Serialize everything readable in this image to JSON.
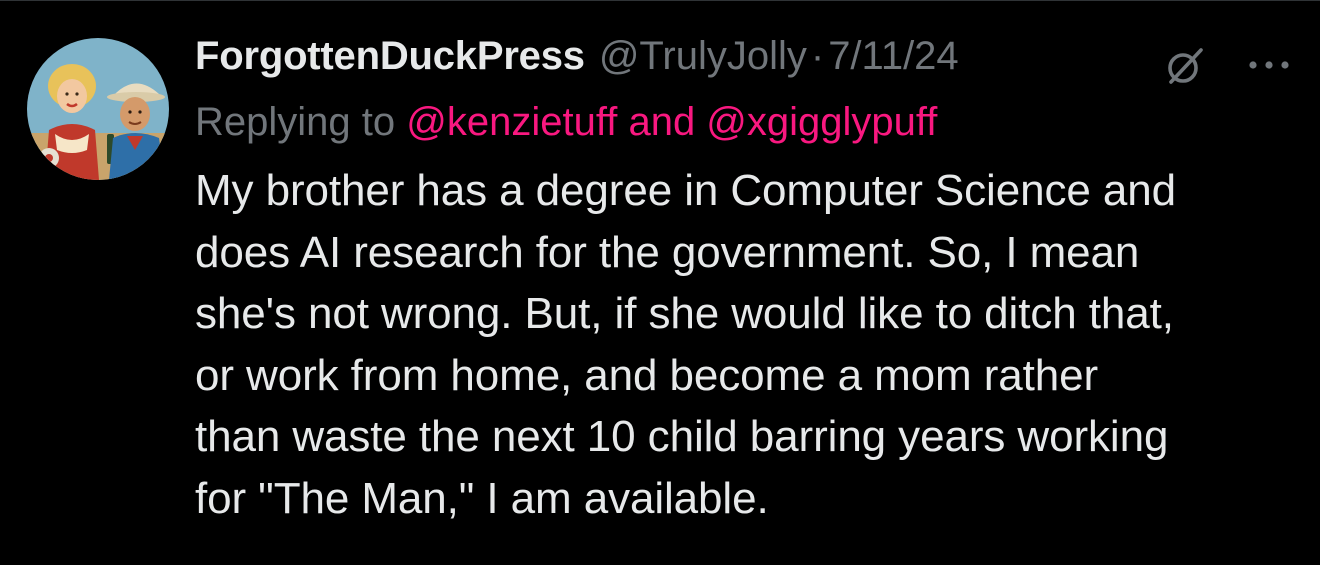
{
  "tweet": {
    "author": {
      "display_name": "ForgottenDuckPress",
      "handle": "@TrulyJolly",
      "avatar_icon": "vintage-pinup-avatar"
    },
    "separator": "·",
    "date": "7/11/24",
    "grok_icon": "grok-icon",
    "more_icon": "more-horizontal-icon",
    "reply": {
      "prefix": "Replying to",
      "mentions": "@kenzietuff and @xgigglypuff"
    },
    "text_lines": [
      "My brother has a degree in Computer Science and",
      "does AI research for the government. So, I mean",
      "she's not wrong. But, if she would like to ditch that,",
      "or work from home, and become a mom rather",
      "than waste the next 10 child barring years working",
      "for \"The Man,\" I am available."
    ]
  },
  "colors": {
    "background": "#000000",
    "primary_text": "#e7e9ea",
    "secondary_text": "#71767b",
    "mention": "#f91880"
  }
}
